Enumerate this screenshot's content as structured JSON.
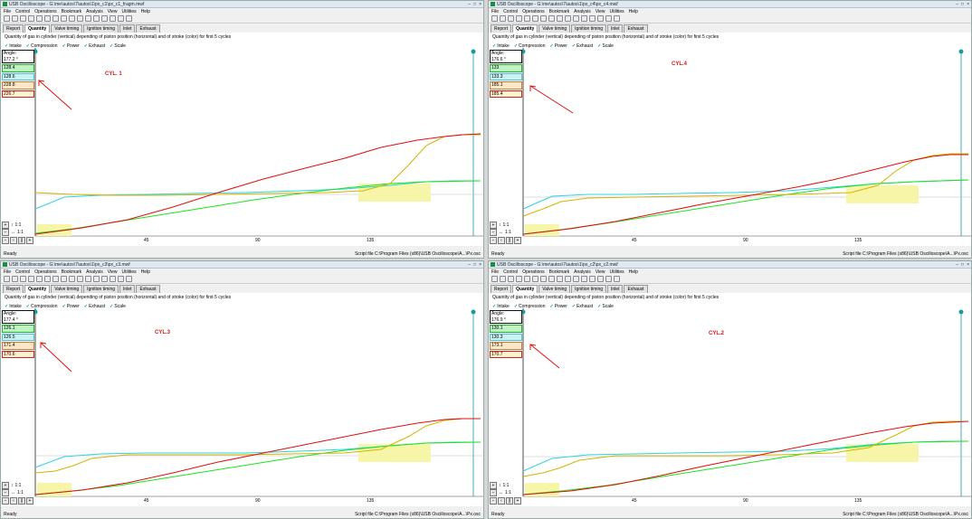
{
  "menu": [
    "File",
    "Control",
    "Operations",
    "Bookmark",
    "Analysis",
    "View",
    "Utilities",
    "Help"
  ],
  "tabs": [
    "Report",
    "Quantity",
    "Valve timing",
    "Ignition timing",
    "Inlet",
    "Exhaust"
  ],
  "active_tab": "Quantity",
  "caption": "Quantity of gas in cylinder (vertical) depending of piston position (horizontal) and of stroke (color) for first 5 cycles",
  "legend": [
    {
      "label": "Intake",
      "color": "#1ea82b"
    },
    {
      "label": "Compression",
      "color": "#18b9c2"
    },
    {
      "label": "Power",
      "color": "#c4a300"
    },
    {
      "label": "Exhaust",
      "color": "#d31818"
    },
    {
      "label": "Scale",
      "color": "#555555"
    }
  ],
  "readout_label": "Angle:",
  "zoom_labels": [
    "1:1",
    "1:1"
  ],
  "x_ticks": [
    "45",
    "90",
    "135"
  ],
  "status_left": "Ready",
  "colors": {
    "intake": "#1ee21e",
    "compression": "#2cd4e0",
    "power": "#d4b400",
    "exhaust": "#dd1111",
    "highlight": "#f7f5a8"
  },
  "windows": [
    {
      "id": "w1",
      "title": "USB Oscilloscope - G:\\me\\autos\\7\\autos\\1\\px_c1\\px_c1_fragm.mwf",
      "cyl_label": "CYL. 1",
      "readouts": [
        "177.2 °",
        "128.4",
        "128.6",
        "228.8",
        "226.7"
      ],
      "status_right": "Script file C:\\Program Files (x86)\\USB Oscilloscope\\A...\\Px.osc"
    },
    {
      "id": "w4",
      "title": "USB Oscilloscope - G:\\me\\autos\\7\\autos\\1\\px_c4\\px_c4.mwf",
      "cyl_label": "CYL.4",
      "readouts": [
        "176.6 °",
        "133",
        "133.3",
        "185.1",
        "185.4"
      ],
      "status_right": "Script file C:\\Program Files (x86)\\USB Oscilloscope\\A...\\Px.osc"
    },
    {
      "id": "w3",
      "title": "USB Oscilloscope - G:\\me\\autos\\7\\autos\\1\\px_c3\\px_c3.mwf",
      "cyl_label": "CYL.3",
      "readouts": [
        "177.4 °",
        "126.1",
        "126.5",
        "171.4",
        "170.6"
      ],
      "status_right": "Script file C:\\Program Files (x86)\\USB Oscilloscope\\A...\\Px.osc"
    },
    {
      "id": "w2",
      "title": "USB Oscilloscope - G:\\me\\autos\\7\\autos\\1\\px_c2\\px_c2.mwf",
      "cyl_label": "CYL.2",
      "readouts": [
        "176.9 °",
        "130.1",
        "130.3",
        "173.1",
        "170.7"
      ],
      "status_right": "Script file C:\\Program Files (x86)\\USB Oscilloscope\\A...\\Px.osc"
    }
  ]
}
